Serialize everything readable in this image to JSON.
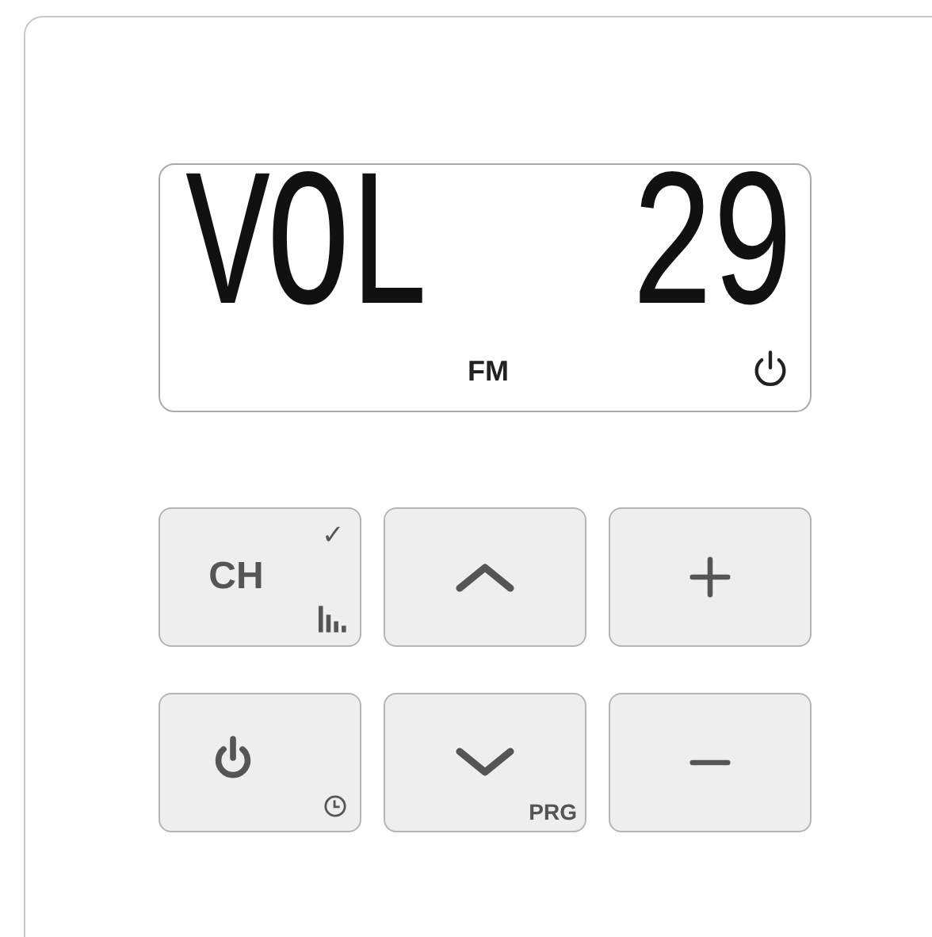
{
  "display": {
    "left_text": "VOL",
    "right_text": "29",
    "band": "FM"
  },
  "buttons": [
    {
      "kind": "label",
      "label": "CH",
      "corner_mark": "✓"
    },
    {
      "kind": "up"
    },
    {
      "kind": "plus"
    },
    {
      "kind": "power"
    },
    {
      "kind": "down",
      "sub_label": "PRG"
    },
    {
      "kind": "minus"
    }
  ]
}
